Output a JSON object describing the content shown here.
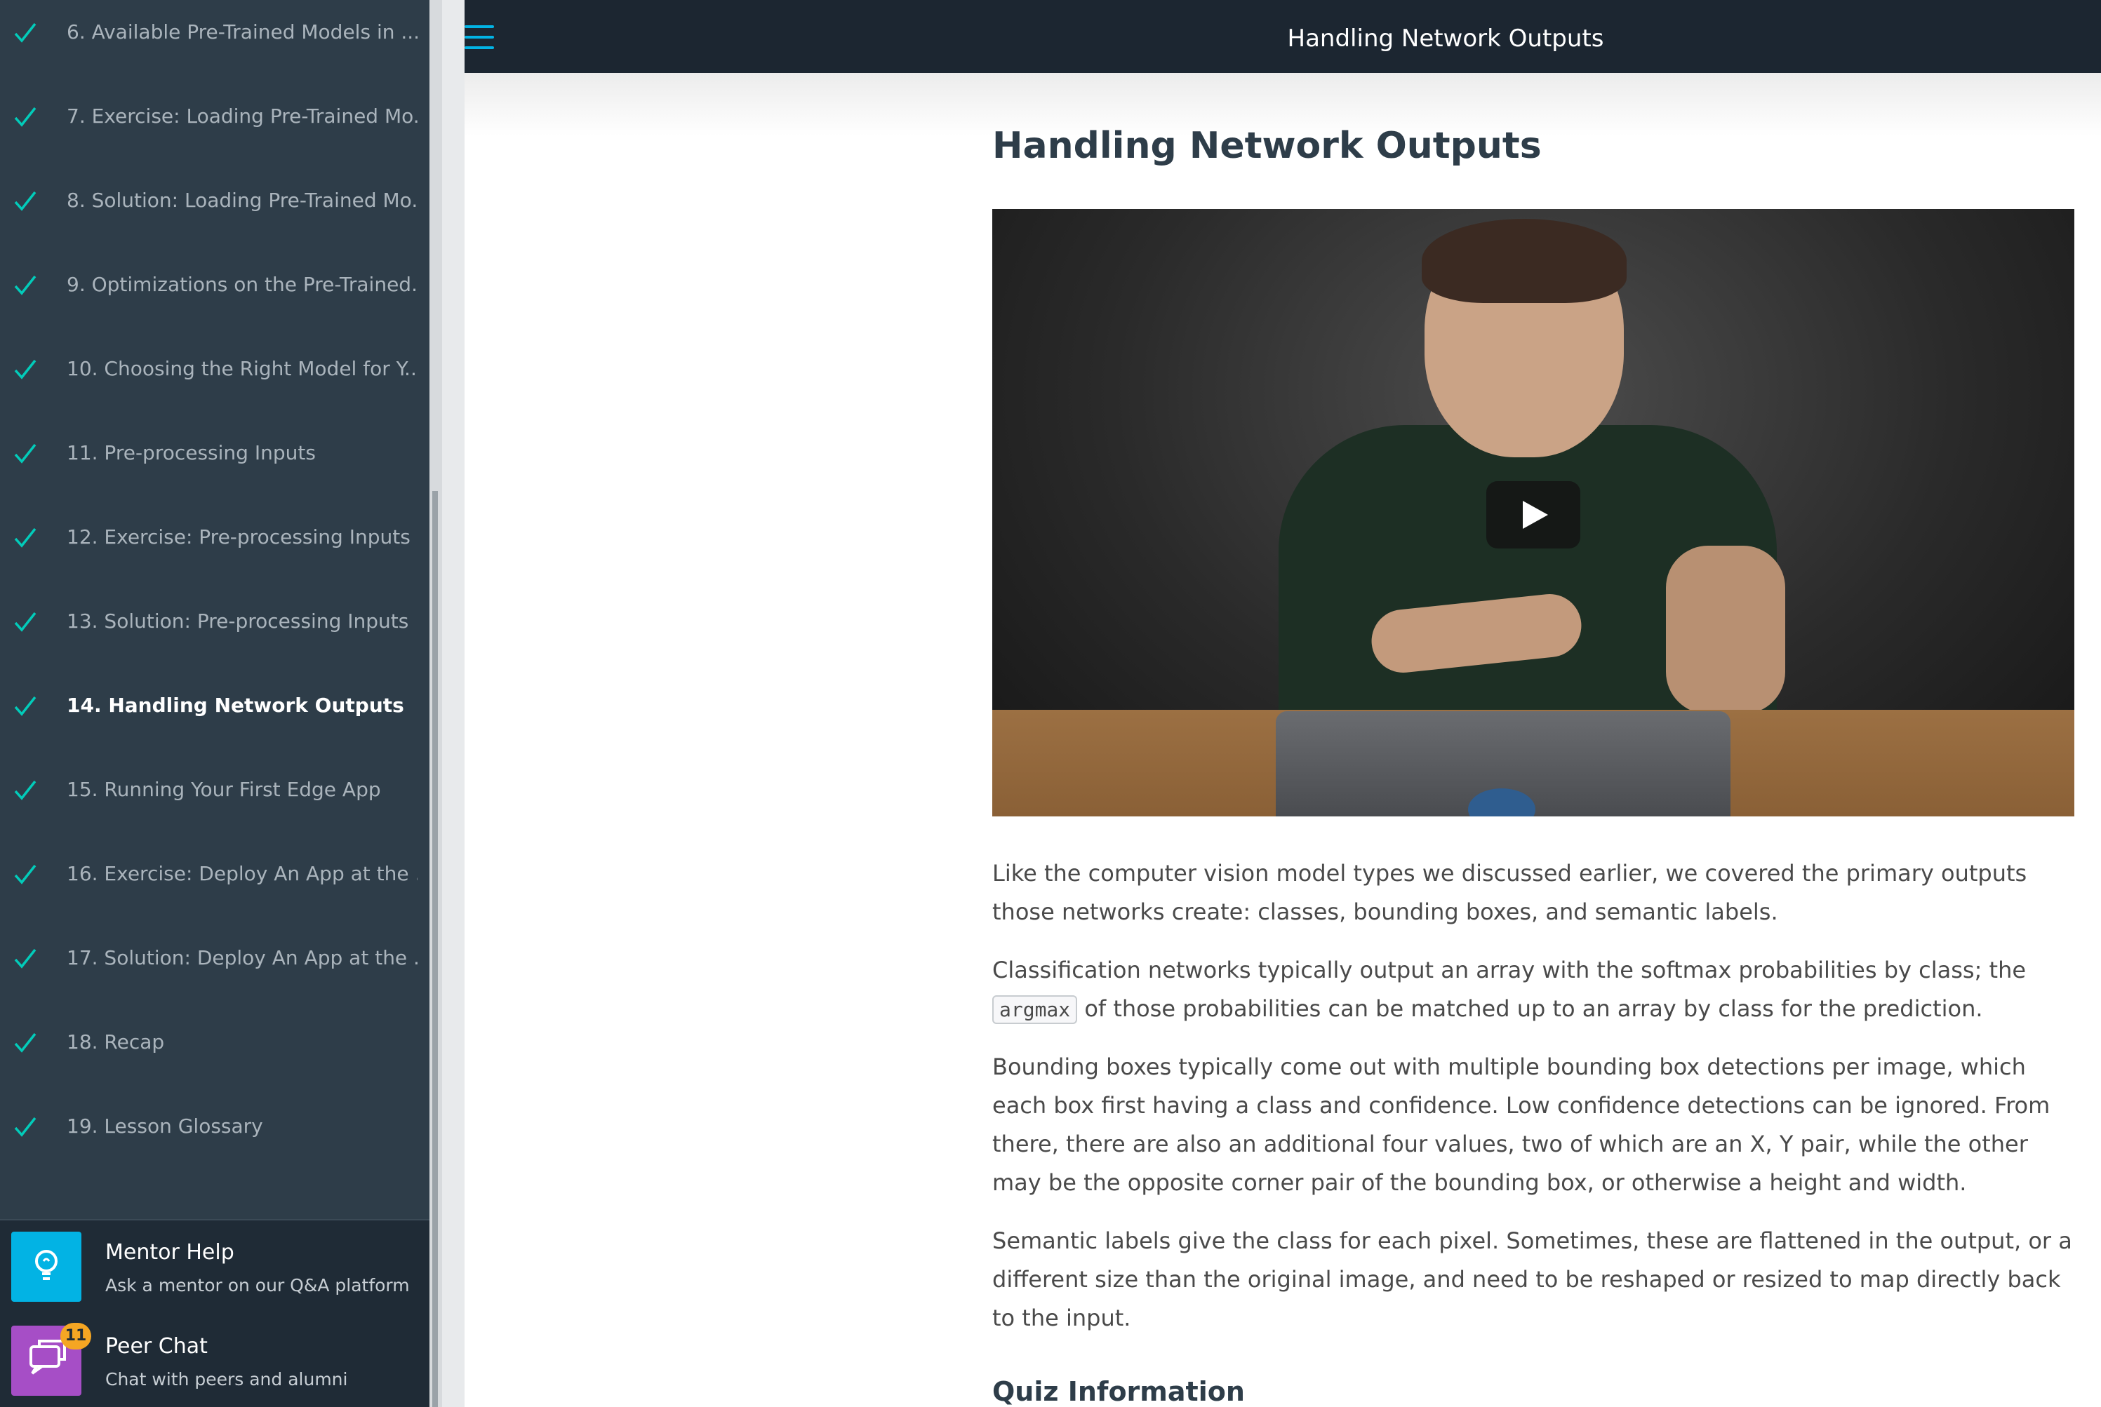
{
  "app": {
    "title": "Handling Network Outputs"
  },
  "sidebar": {
    "items": [
      {
        "label": "6. Available Pre-Trained Models in ...",
        "done": true,
        "active": false
      },
      {
        "label": "7. Exercise: Loading Pre-Trained Mo...",
        "done": true,
        "active": false
      },
      {
        "label": "8. Solution: Loading Pre-Trained Mo...",
        "done": true,
        "active": false
      },
      {
        "label": "9. Optimizations on the Pre-Trained...",
        "done": true,
        "active": false
      },
      {
        "label": "10. Choosing the Right Model for Y...",
        "done": true,
        "active": false
      },
      {
        "label": "11. Pre-processing Inputs",
        "done": true,
        "active": false
      },
      {
        "label": "12. Exercise: Pre-processing Inputs",
        "done": true,
        "active": false
      },
      {
        "label": "13. Solution: Pre-processing Inputs",
        "done": true,
        "active": false
      },
      {
        "label": "14. Handling Network Outputs",
        "done": true,
        "active": true
      },
      {
        "label": "15. Running Your First Edge App",
        "done": true,
        "active": false
      },
      {
        "label": "16. Exercise: Deploy An App at the ...",
        "done": true,
        "active": false
      },
      {
        "label": "17. Solution: Deploy An App at the ...",
        "done": true,
        "active": false
      },
      {
        "label": "18. Recap",
        "done": true,
        "active": false
      },
      {
        "label": "19. Lesson Glossary",
        "done": true,
        "active": false
      }
    ],
    "mentor_help": {
      "title": "Mentor Help",
      "subtitle": "Ask a mentor on our Q&A platform",
      "icon": "lightbulb-icon",
      "color": "#02b3e4"
    },
    "peer_chat": {
      "title": "Peer Chat",
      "subtitle": "Chat with peers and alumni",
      "badge": "11",
      "icon": "chat-bubbles-icon",
      "color": "#a64ec6"
    }
  },
  "content": {
    "title": "Handling Network Outputs",
    "video": {
      "play_icon": "play-icon"
    },
    "para1": "Like the computer vision model types we discussed earlier, we covered the primary outputs those networks create: classes, bounding boxes, and semantic labels.",
    "para2_before": "Classification networks typically output an array with the softmax probabilities by class; the ",
    "para2_code": "argmax",
    "para2_after": " of those probabilities can be matched up to an array by class for the prediction.",
    "para3": "Bounding boxes typically come out with multiple bounding box detections per image, which each box first having a class and confidence. Low confidence detections can be ignored. From there, there are also an additional four values, two of which are an X, Y pair, while the other may be the opposite corner pair of the bounding box, or otherwise a height and width.",
    "para4": "Semantic labels give the class for each pixel. Sometimes, these are flattened in the output, or a different size than the original image, and need to be reshaped or resized to map directly back to the input.",
    "quiz_title": "Quiz Information"
  },
  "colors": {
    "accent": "#02b3e4",
    "sidebar_bg": "#2e3d49",
    "check": "#02ccba"
  }
}
